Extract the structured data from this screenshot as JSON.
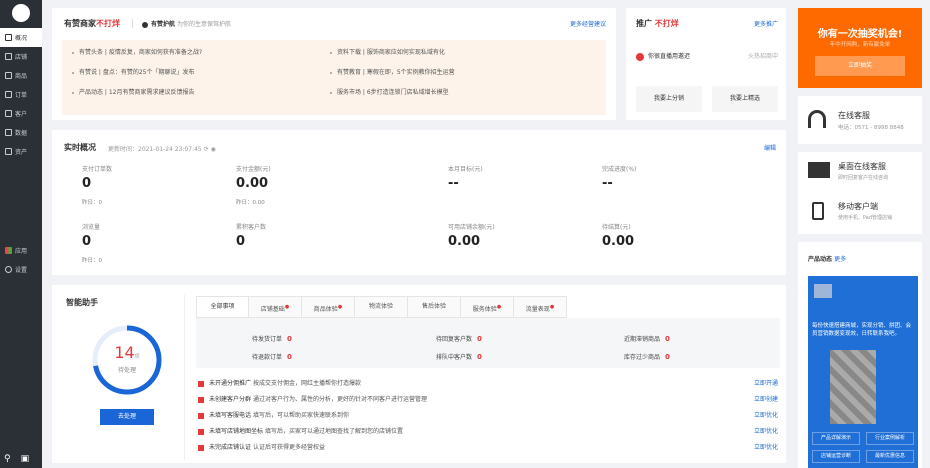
{
  "sidebar": {
    "items": [
      {
        "label": "概况",
        "icon": "overview-icon"
      },
      {
        "label": "店铺",
        "icon": "store-icon"
      },
      {
        "label": "商品",
        "icon": "goods-icon"
      },
      {
        "label": "订单",
        "icon": "order-icon"
      },
      {
        "label": "客户",
        "icon": "customer-icon"
      },
      {
        "label": "数据",
        "icon": "data-icon"
      },
      {
        "label": "资产",
        "icon": "asset-icon"
      }
    ],
    "apps": {
      "label": "应用"
    },
    "settings": {
      "label": "设置"
    }
  },
  "notice": {
    "title_prefix": "有赞商家",
    "title_highlight": "不打烊",
    "guard_label": "有赞护航",
    "guard_desc": "为你的生意保驾护航",
    "more_link": "更多经营建议",
    "left_items": [
      "有赞头条  |  疫情反复，商家如何获有准备之战?",
      "有赞说  |  盘点：有赞的25个「期聊说」发布",
      "产品动态  |  12月有赞商家需求建议反馈报告"
    ],
    "right_items": [
      "资料下载  |  服饰商家应如何实现私域有化",
      "有赞教育  |  寒假在即，5个实例教你招生运营",
      "服务市场  |  6步打造连锁门店私域增长模型"
    ]
  },
  "promo": {
    "title_prefix": "推广",
    "title_highlight": "不打烊",
    "more_link": "更多推广",
    "item_label": "你很直播用邀迟",
    "item_status": "火热招商中",
    "btn_left": "我要上分销",
    "btn_right": "我要上精选"
  },
  "realtime": {
    "title": "实时概况",
    "update_time": "更新时间：2021-01-24 23:07:45",
    "edit_link": "编辑",
    "stats": [
      {
        "label": "支付订单数",
        "value": "0",
        "sub": "昨日：0"
      },
      {
        "label": "支付金额(元)",
        "value": "0.00",
        "sub": "昨日：0.00"
      },
      {
        "label": "本月目标(元)",
        "value": "--",
        "sub": ""
      },
      {
        "label": "完成进度(%)",
        "value": "--",
        "sub": ""
      },
      {
        "label": "浏览量",
        "value": "0",
        "sub": "昨日：0"
      },
      {
        "label": "累积客户数",
        "value": "0",
        "sub": ""
      },
      {
        "label": "可用店铺余额(元)",
        "value": "0.00",
        "sub": ""
      },
      {
        "label": "待结算(元)",
        "value": "0.00",
        "sub": ""
      }
    ]
  },
  "assistant": {
    "title": "智能助手",
    "count": "14",
    "count_unit": "项",
    "count_label": "待处理",
    "progress": 0.72,
    "btn": "去处理",
    "tabs": [
      {
        "label": "全部事项",
        "dot": false
      },
      {
        "label": "店铺基础",
        "dot": true
      },
      {
        "label": "商品体验",
        "dot": true
      },
      {
        "label": "物流体验",
        "dot": false
      },
      {
        "label": "售后体验",
        "dot": false
      },
      {
        "label": "服务体验",
        "dot": true
      },
      {
        "label": "流量表现",
        "dot": true
      }
    ],
    "todos": [
      {
        "label": "待发货订单",
        "value": "0"
      },
      {
        "label": "待回复客户数",
        "value": "0"
      },
      {
        "label": "近期滞销商品",
        "value": "0"
      },
      {
        "label": "待退款订单",
        "value": "0"
      },
      {
        "label": "排队中客户数",
        "value": "0"
      },
      {
        "label": "库存过少商品",
        "value": "0"
      }
    ],
    "tasks": [
      {
        "title": "未开通分佣推广",
        "desc": "按成交支付佣金，网红主播帮你打造爆款",
        "action": "立即开通"
      },
      {
        "title": "未创建客户分群",
        "desc": "通过对客户行为、属性的分析，更好的针对不同客户进行运营管理",
        "action": "立即创建"
      },
      {
        "title": "未填写客服电话",
        "desc": "填写后，可以帮助买家快速联系到你",
        "action": "立即优化"
      },
      {
        "title": "未填写店铺地图坐标",
        "desc": "填写后，买家可以通过地图查找了解到您的店铺位置",
        "action": "立即优化"
      },
      {
        "title": "未完成店铺认证",
        "desc": "认证后可获得更多经营权益",
        "action": "立即优化"
      }
    ]
  },
  "lottery": {
    "title": "你有一次抽奖机会!",
    "subtitle": "年中开网购，新有赢免单",
    "btn": "立即抽奖"
  },
  "service": {
    "title": "在线客服",
    "phone": "电话：0571 - 8998 8848"
  },
  "desktop": {
    "title": "桌面在线客服",
    "desc": "即时回复客户在线咨询"
  },
  "mobile": {
    "title": "移动客户端",
    "desc": "使用手机、Pad管理店铺"
  },
  "product_news": {
    "title": "产品动态",
    "more": "更多",
    "banner_text": "每份快速搭建商城，实现分销、拼团、会员营销数据变现效，日转联系我吧。",
    "links": [
      "产品详解演示",
      "行业案例解析",
      "店铺运营诊断",
      "最新优惠信息"
    ]
  },
  "colors": {
    "sidebar_bg": "#2b2f36",
    "accent_red": "#e4393c",
    "link_blue": "#1a66d6",
    "lottery_orange": "#ff6a00",
    "banner_blue": "#1f6fd6"
  }
}
